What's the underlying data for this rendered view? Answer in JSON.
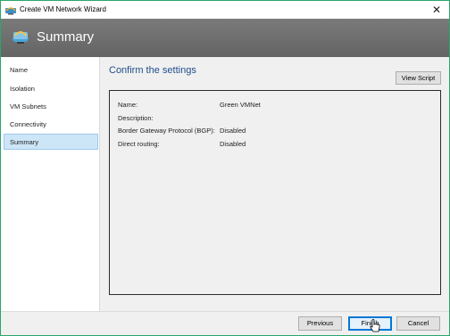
{
  "window": {
    "title": "Create VM Network Wizard",
    "close_glyph": "✕",
    "border_color": "#2aa66d"
  },
  "header": {
    "title": "Summary",
    "icon": "network-icon"
  },
  "sidebar": {
    "items": [
      {
        "label": "Name",
        "active": false
      },
      {
        "label": "Isolation",
        "active": false
      },
      {
        "label": "VM Subnets",
        "active": false
      },
      {
        "label": "Connectivity",
        "active": false
      },
      {
        "label": "Summary",
        "active": true
      }
    ]
  },
  "main": {
    "section_title": "Confirm the settings",
    "view_script_label": "View Script",
    "details": [
      {
        "label": "Name:",
        "value": "Green VMNet"
      },
      {
        "label": "Description:",
        "value": ""
      },
      {
        "label": "Border Gateway Protocol (BGP):",
        "value": "Disabled"
      },
      {
        "label": "Direct routing:",
        "value": "Disabled"
      }
    ]
  },
  "footer": {
    "previous_label": "Previous",
    "finish_label": "Finish",
    "cancel_label": "Cancel"
  },
  "colors": {
    "accent_title": "#1f4e8c",
    "header_bg": "#6e6e6e",
    "selected_bg": "#cde6f7",
    "primary_border": "#0078d7"
  }
}
